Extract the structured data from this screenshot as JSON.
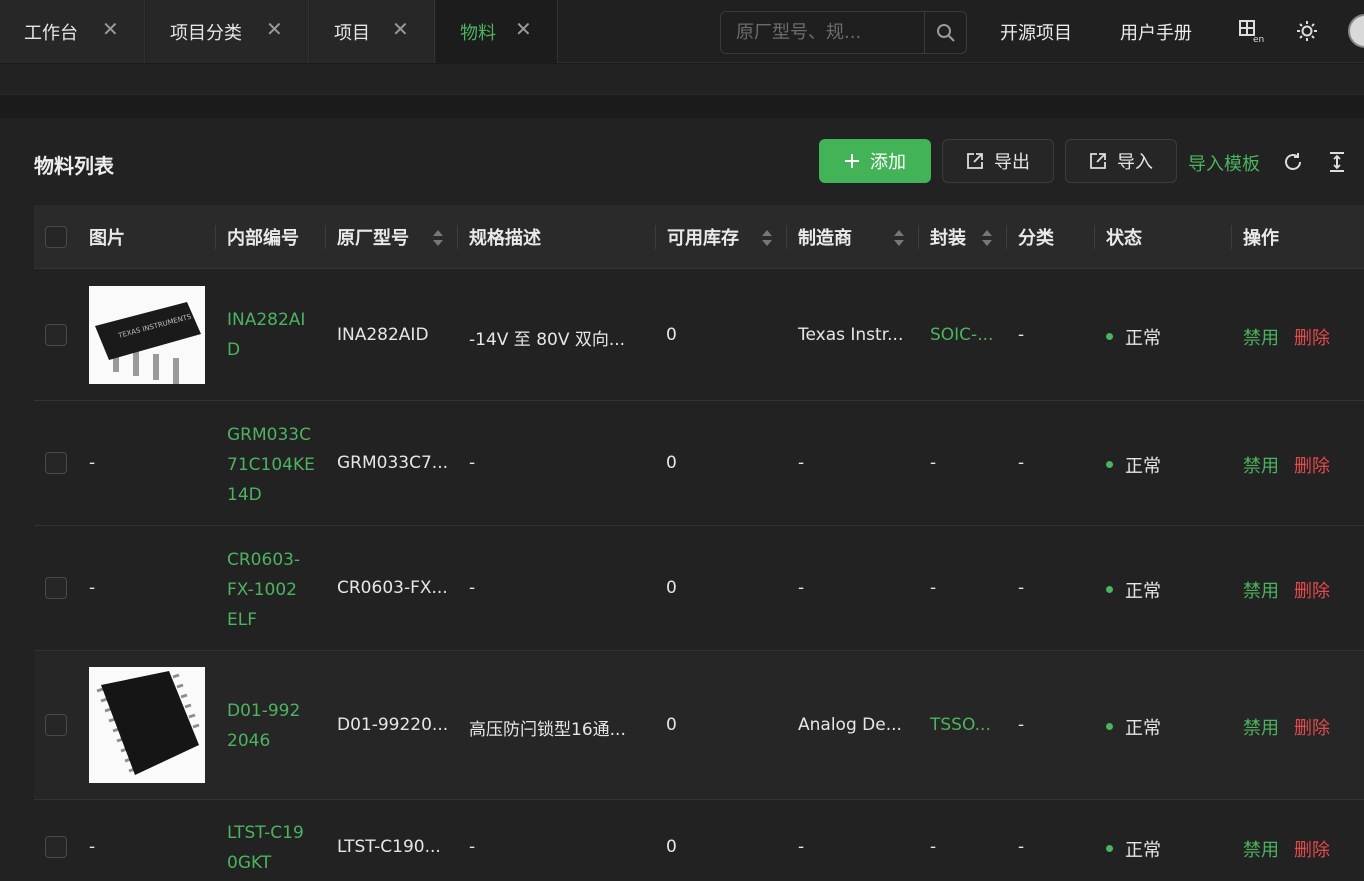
{
  "tabs": [
    {
      "label": "工作台"
    },
    {
      "label": "项目分类"
    },
    {
      "label": "项目"
    },
    {
      "label": "物料"
    }
  ],
  "search": {
    "placeholder": "原厂型号、规..."
  },
  "nav": {
    "open_source": "开源项目",
    "manual": "用户手册"
  },
  "card": {
    "title": "物料列表",
    "add_label": "添加",
    "export_label": "导出",
    "import_label": "导入",
    "import_template_label": "导入模板"
  },
  "table": {
    "columns": {
      "image": "图片",
      "internal_no": "内部编号",
      "mfr_model": "原厂型号",
      "spec": "规格描述",
      "stock": "可用库存",
      "manufacturer": "制造商",
      "package": "封装",
      "category": "分类",
      "status": "状态",
      "actions": "操作"
    },
    "rows": [
      {
        "internal_no": "INA282AID",
        "mfr_model": "INA282AID",
        "spec": "-14V 至 80V 双向...",
        "stock": "0",
        "manufacturer": "Texas Instr...",
        "package": "SOIC-...",
        "category": "-",
        "status": "正常",
        "disable": "禁用",
        "delete": "删除",
        "image": "soic-chip-photo"
      },
      {
        "internal_no": "GRM033C71C104KE14D",
        "mfr_model": "GRM033C7...",
        "spec": "-",
        "stock": "0",
        "manufacturer": "-",
        "package": "-",
        "category": "-",
        "status": "正常",
        "disable": "禁用",
        "delete": "删除",
        "image_text": "-"
      },
      {
        "internal_no": "CR0603-FX-1002ELF",
        "mfr_model": "CR0603-FX...",
        "spec": "-",
        "stock": "0",
        "manufacturer": "-",
        "package": "-",
        "category": "-",
        "status": "正常",
        "disable": "禁用",
        "delete": "删除",
        "image_text": "-"
      },
      {
        "internal_no": "D01-9922046",
        "mfr_model": "D01-99220...",
        "spec": "高压防闩锁型16通...",
        "stock": "0",
        "manufacturer": "Analog De...",
        "package": "TSSO...",
        "category": "-",
        "status": "正常",
        "disable": "禁用",
        "delete": "删除",
        "image": "tssop-chip-photo"
      },
      {
        "internal_no": "LTST-C190GKT",
        "mfr_model": "LTST-C190...",
        "spec": "-",
        "stock": "0",
        "manufacturer": "-",
        "package": "-",
        "category": "-",
        "status": "正常",
        "disable": "禁用",
        "delete": "删除",
        "image_text": "-"
      }
    ]
  },
  "colors": {
    "accent": "#42b357",
    "danger": "#e24b4b",
    "bg": "#1b1b1b"
  }
}
